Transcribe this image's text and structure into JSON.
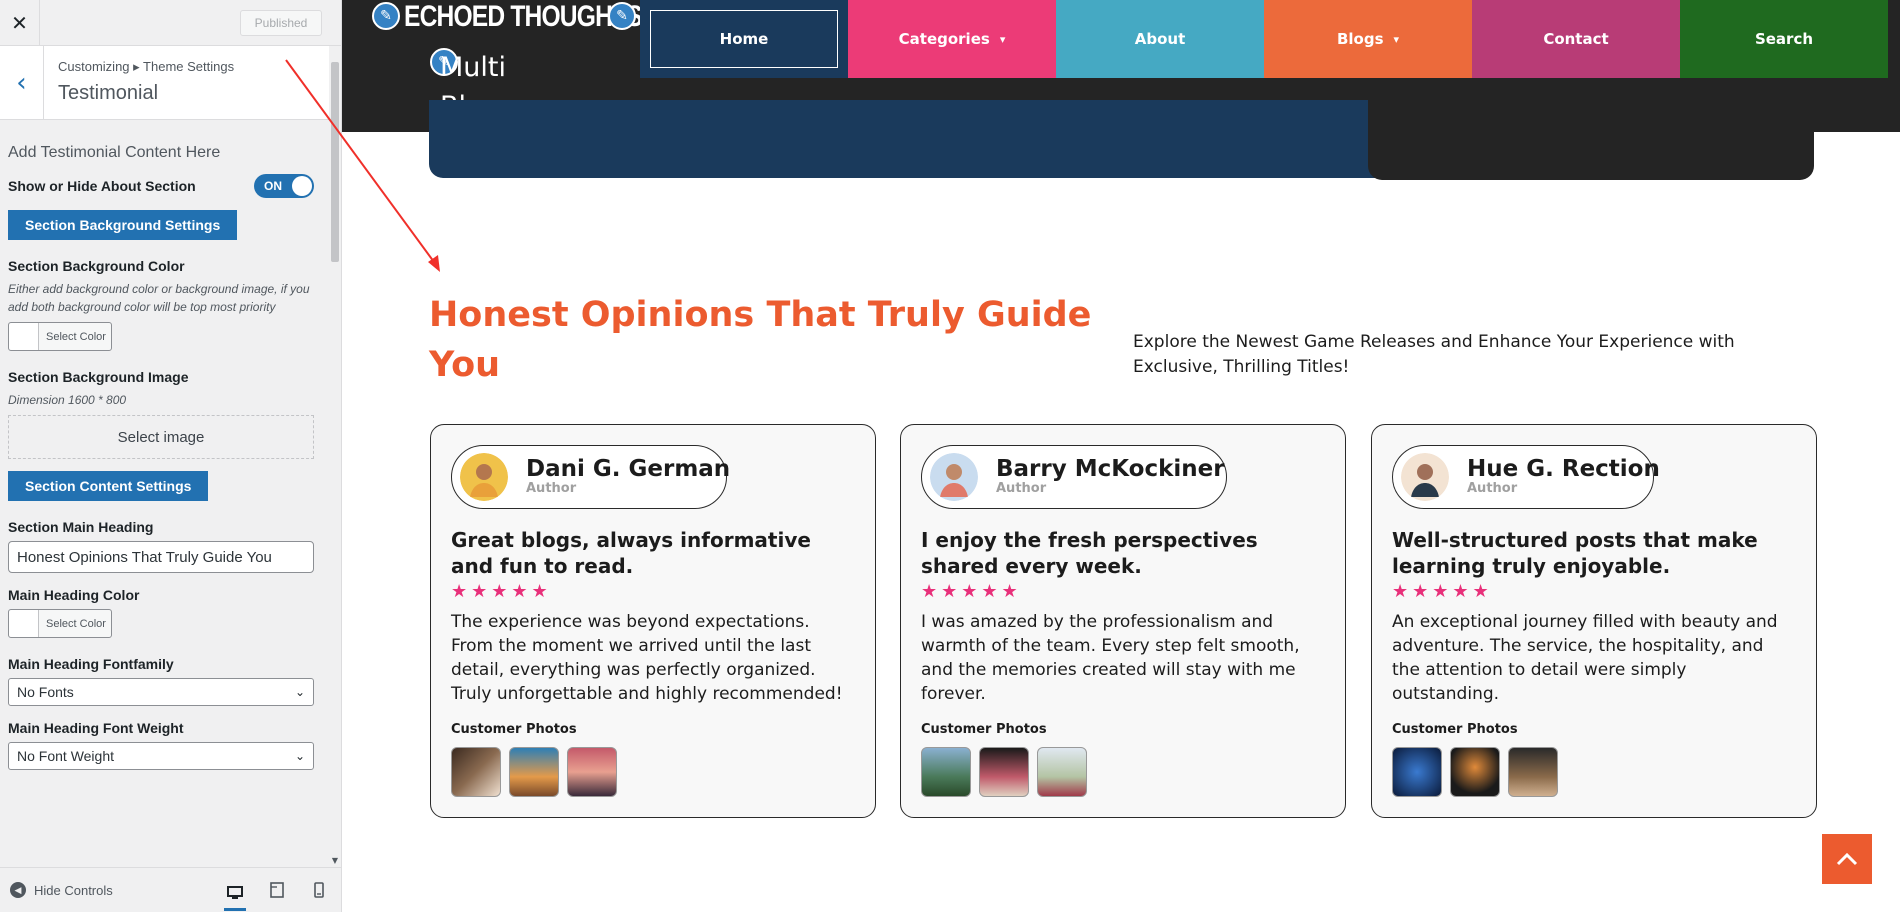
{
  "customizer": {
    "published_label": "Published",
    "breadcrumb": "Customizing ▸ Theme Settings",
    "section_title": "Testimonial",
    "intro_text": "Add Testimonial Content Here",
    "show_hide_label": "Show or Hide About Section",
    "toggle_state": "ON",
    "bg_settings_button": "Section Background Settings",
    "bg_color_label": "Section Background Color",
    "bg_color_desc": "Either add background color or background image, if you add both background color will be top most priority",
    "select_color_label": "Select Color",
    "bg_image_label": "Section Background Image",
    "bg_image_desc": "Dimension 1600 * 800",
    "select_image_label": "Select image",
    "content_settings_button": "Section Content Settings",
    "main_heading_label": "Section Main Heading",
    "main_heading_value": "Honest Opinions That Truly Guide You",
    "main_heading_color_label": "Main Heading Color",
    "main_heading_font_label": "Main Heading Fontfamily",
    "main_heading_font_value": "No Fonts",
    "main_heading_weight_label": "Main Heading Font Weight",
    "main_heading_weight_value": "No Font Weight",
    "hide_controls_label": "Hide Controls"
  },
  "site": {
    "title": "ECHOED THOUGHTS",
    "tagline": "Multi Blogger",
    "nav": [
      {
        "label": "Home",
        "color": "#1a3a5c"
      },
      {
        "label": "Categories",
        "color": "#ec3b77"
      },
      {
        "label": "About",
        "color": "#45a9c3"
      },
      {
        "label": "Blogs",
        "color": "#ec6a3b"
      },
      {
        "label": "Contact",
        "color": "#b83c76"
      },
      {
        "label": "Search",
        "color": "#1f6a1f"
      }
    ]
  },
  "testimonials": {
    "heading": "Honest Opinions That Truly Guide You",
    "subheading": "Explore the Newest Game Releases and Enhance Your Experience with Exclusive, Thrilling Titles!",
    "photos_label": "Customer Photos",
    "stars": "★★★★★",
    "items": [
      {
        "name": "Dani G. German",
        "role": "Author",
        "title": "Great blogs, always informative and fun to read.",
        "text": "The experience was beyond expectations. From the moment we arrived until the last detail, everything was perfectly organized. Truly unforgettable and highly recommended!"
      },
      {
        "name": "Barry McKockiner",
        "role": "Author",
        "title": "I enjoy the fresh perspectives shared every week.",
        "text": "I was amazed by the professionalism and warmth of the team. Every step felt smooth, and the memories created will stay with me forever."
      },
      {
        "name": "Hue G. Rection",
        "role": "Author",
        "title": "Well-structured posts that make learning truly enjoyable.",
        "text": "An exceptional journey filled with beauty and adventure. The service, the hospitality, and the attention to detail were simply outstanding."
      }
    ]
  },
  "colors": {
    "accent_orange": "#ec5b2f",
    "star_pink": "#e8307a",
    "wp_blue": "#2271b1",
    "annotation_red": "#f0302a"
  }
}
